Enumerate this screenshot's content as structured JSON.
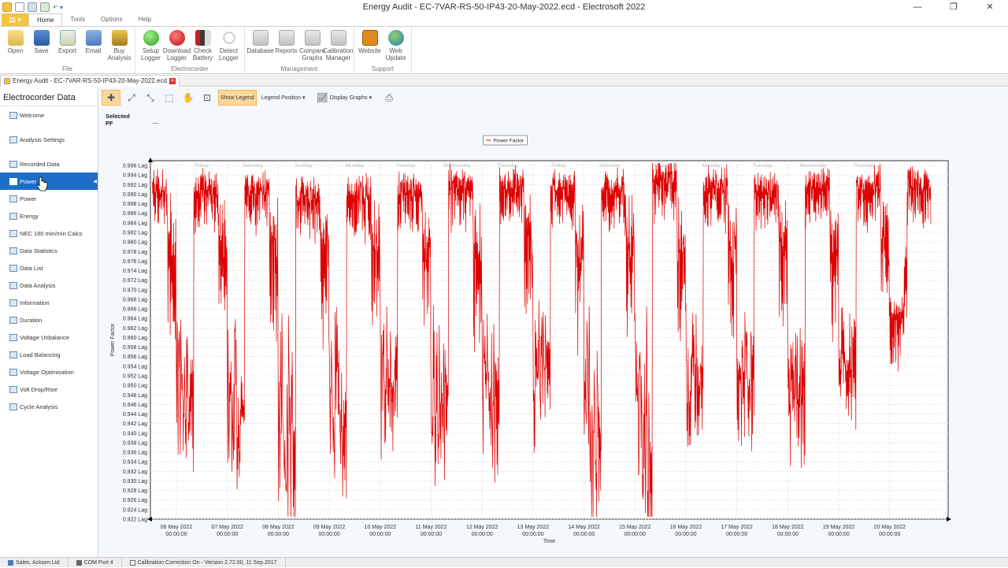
{
  "window": {
    "title": "Energy Audit - EC-7VAR-RS-50-IP43-20-May-2022.ecd - Electrosoft 2022"
  },
  "menu": {
    "tabs": [
      "Home",
      "Tools",
      "Options",
      "Help"
    ]
  },
  "ribbon": {
    "groups": [
      {
        "label": "File",
        "buttons": [
          {
            "label": "Open",
            "icon": "open"
          },
          {
            "label": "Save",
            "icon": "save"
          },
          {
            "label": "Export",
            "icon": "export"
          },
          {
            "label": "Email",
            "icon": "email"
          },
          {
            "label": "Buy Analysis",
            "icon": "buy"
          }
        ]
      },
      {
        "label": "Electrocorder",
        "buttons": [
          {
            "label": "Setup Logger",
            "icon": "green"
          },
          {
            "label": "Download Logger",
            "icon": "red"
          },
          {
            "label": "Check Battery",
            "icon": "battery"
          },
          {
            "label": "Detect Logger",
            "icon": "search"
          }
        ]
      },
      {
        "label": "Management",
        "buttons": [
          {
            "label": "Database",
            "icon": "gray"
          },
          {
            "label": "Reports",
            "icon": "gray"
          },
          {
            "label": "Compare Graphs",
            "icon": "gray"
          },
          {
            "label": "Calibration Manager",
            "icon": "gray"
          }
        ]
      },
      {
        "label": "Support",
        "buttons": [
          {
            "label": "Website",
            "icon": "orange"
          },
          {
            "label": "Web Update",
            "icon": "globe"
          }
        ]
      }
    ]
  },
  "doc_tab": {
    "label": "Energy Audit - EC-7VAR-RS-50-IP43-20-May-2022.ecd"
  },
  "sidebar": {
    "title": "Electrocorder Data",
    "items": [
      {
        "label": "Welcome",
        "gap_after": true
      },
      {
        "label": "Analysis Settings",
        "gap_after": true
      },
      {
        "label": "Recorded Data"
      },
      {
        "label": "Power",
        "active": true
      },
      {
        "label": "Power"
      },
      {
        "label": "Energy"
      },
      {
        "label": "NEC 180 min/min Calcs"
      },
      {
        "label": "Data Statistics"
      },
      {
        "label": "Data List"
      },
      {
        "label": "Data Analysis"
      },
      {
        "label": "Information"
      },
      {
        "label": "Duration"
      },
      {
        "label": "Voltage Unbalance"
      },
      {
        "label": "Load Balancing"
      },
      {
        "label": "Voltage Optimisation"
      },
      {
        "label": "Volt Drop/Rise"
      },
      {
        "label": "Cycle Analysis"
      }
    ]
  },
  "toolbar": {
    "show_legend": "Show Legend",
    "legend_position": "Legend Position",
    "display_graphs": "Display Graphs"
  },
  "selected": {
    "heading": "Selected",
    "key": "PF",
    "value": "---"
  },
  "chart_data": {
    "type": "line",
    "legend": "Power Factor",
    "ylabel": "Power Factor",
    "xlabel": "Time",
    "ylim": [
      0.922,
      0.997
    ],
    "y_ticks": [
      "0.996 Lag",
      "0.994 Lag",
      "0.992 Lag",
      "0.990 Lag",
      "0.988 Lag",
      "0.986 Lag",
      "0.984 Lag",
      "0.982 Lag",
      "0.980 Lag",
      "0.978 Lag",
      "0.976 Lag",
      "0.974 Lag",
      "0.972 Lag",
      "0.970 Lag",
      "0.968 Lag",
      "0.966 Lag",
      "0.964 Lag",
      "0.962 Lag",
      "0.960 Lag",
      "0.958 Lag",
      "0.956 Lag",
      "0.954 Lag",
      "0.952 Lag",
      "0.950 Lag",
      "0.948 Lag",
      "0.946 Lag",
      "0.944 Lag",
      "0.942 Lag",
      "0.940 Lag",
      "0.938 Lag",
      "0.936 Lag",
      "0.934 Lag",
      "0.932 Lag",
      "0.930 Lag",
      "0.928 Lag",
      "0.926 Lag",
      "0.924 Lag",
      "0.922 Lag"
    ],
    "x_ticks": [
      {
        "date": "06 May 2022",
        "time": "00:00:00"
      },
      {
        "date": "07 May 2022",
        "time": "00:00:00"
      },
      {
        "date": "08 May 2022",
        "time": "00:00:00"
      },
      {
        "date": "09 May 2022",
        "time": "00:00:00"
      },
      {
        "date": "10 May 2022",
        "time": "00:00:00"
      },
      {
        "date": "11 May 2022",
        "time": "00:00:00"
      },
      {
        "date": "12 May 2022",
        "time": "00:00:00"
      },
      {
        "date": "13 May 2022",
        "time": "00:00:00"
      },
      {
        "date": "14 May 2022",
        "time": "00:00:00"
      },
      {
        "date": "15 May 2022",
        "time": "00:00:00"
      },
      {
        "date": "16 May 2022",
        "time": "00:00:00"
      },
      {
        "date": "17 May 2022",
        "time": "00:00:00"
      },
      {
        "date": "18 May 2022",
        "time": "00:00:00"
      },
      {
        "date": "19 May 2022",
        "time": "00:00:00"
      },
      {
        "date": "20 May 2022",
        "time": "00:00:00"
      }
    ],
    "day_labels": [
      "Friday",
      "Saturday",
      "Sunday",
      "Monday",
      "Tuesday",
      "Wednesday",
      "Thursday",
      "Friday",
      "Saturday",
      "Sunday",
      "Monday",
      "Tuesday",
      "Wednesday",
      "Thursday"
    ],
    "days": [
      {
        "date": "05 May 2022",
        "day_high": 0.993,
        "night_low": 0.95
      },
      {
        "date": "06 May 2022",
        "day_high": 0.993,
        "night_low": 0.94
      },
      {
        "date": "07 May 2022",
        "day_high": 0.993,
        "night_low": 0.935
      },
      {
        "date": "08 May 2022",
        "day_high": 0.992,
        "night_low": 0.926
      },
      {
        "date": "09 May 2022",
        "day_high": 0.992,
        "night_low": 0.933
      },
      {
        "date": "10 May 2022",
        "day_high": 0.993,
        "night_low": 0.945
      },
      {
        "date": "11 May 2022",
        "day_high": 0.994,
        "night_low": 0.938
      },
      {
        "date": "12 May 2022",
        "day_high": 0.994,
        "night_low": 0.94
      },
      {
        "date": "13 May 2022",
        "day_high": 0.993,
        "night_low": 0.945
      },
      {
        "date": "14 May 2022",
        "day_high": 0.993,
        "night_low": 0.93
      },
      {
        "date": "15 May 2022",
        "day_high": 0.996,
        "night_low": 0.924
      },
      {
        "date": "16 May 2022",
        "day_high": 0.994,
        "night_low": 0.943
      },
      {
        "date": "17 May 2022",
        "day_high": 0.993,
        "night_low": 0.945
      },
      {
        "date": "18 May 2022",
        "day_high": 0.994,
        "night_low": 0.943
      },
      {
        "date": "19 May 2022",
        "day_high": 0.994,
        "night_low": 0.95
      },
      {
        "date": "20 May 2022",
        "day_high": 0.994,
        "night_low": 0.964
      }
    ],
    "color": "#dd0000",
    "grid": true,
    "legend_position": "top-center"
  },
  "statusbar": {
    "user": "Sales, Acksen Ltd",
    "port": "COM Port 4",
    "calibration": "Calibration Correction On - Version 2.72.00, 11 Sep 2017"
  }
}
